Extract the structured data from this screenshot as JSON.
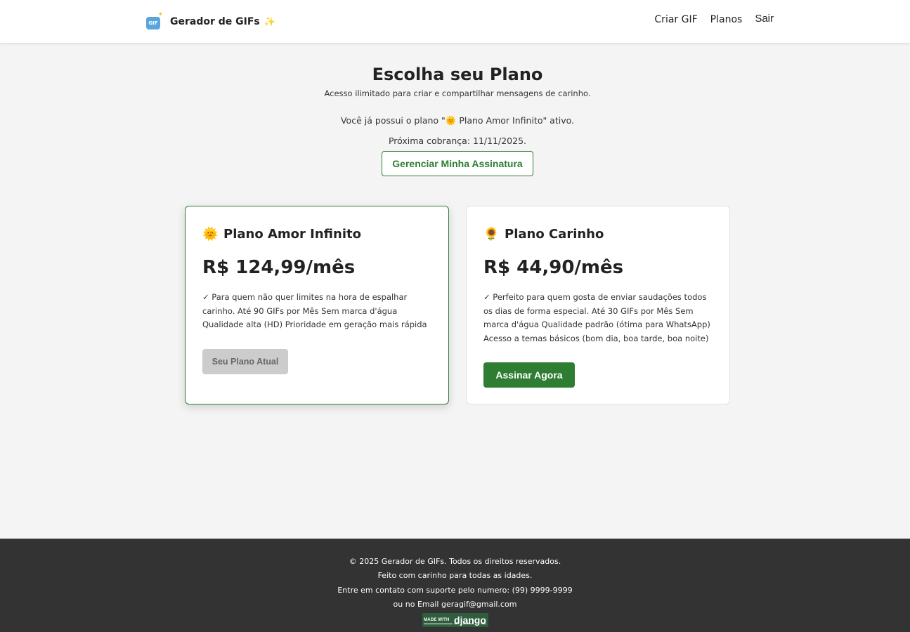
{
  "header": {
    "logo_icon": "gif-icon",
    "logo_text": "GIF",
    "brand_name": "Gerador de GIFs",
    "brand_emoji": "✨",
    "nav": {
      "criar": "Criar GIF",
      "planos": "Planos",
      "sair": "Sair"
    }
  },
  "hero": {
    "title": "Escolha seu Plano",
    "subtitle": "Acesso ilimitado para criar e compartilhar mensagens de carinho.",
    "current_plan_text": "Você já possui o plano \"🌞 Plano Amor Infinito\" ativo.",
    "next_billing": "Próxima cobrança: 11/11/2025.",
    "manage_button": "Gerenciar Minha Assinatura"
  },
  "plans": [
    {
      "icon": "sun-icon",
      "icon_glyph": "🌞",
      "name": "Plano Amor Infinito",
      "price": "R$ 124,99/mês",
      "description": "✓ Para quem não quer limites na hora de espalhar carinho. Até 90 GIFs por Mês Sem marca d'água Qualidade alta (HD) Prioridade em geração mais rápida",
      "button": "Seu Plano Atual",
      "active": true
    },
    {
      "icon": "sunflower-icon",
      "icon_glyph": "🌻",
      "name": "Plano Carinho",
      "price": "R$ 44,90/mês",
      "description": "✓ Perfeito para quem gosta de enviar saudações todos os dias de forma especial. Até 30 GIFs por Mês Sem marca d'água Qualidade padrão (ótima para WhatsApp) Acesso a temas básicos (bom dia, boa tarde, boa noite)",
      "button": "Assinar Agora",
      "active": false
    }
  ],
  "footer": {
    "copyright": "© 2025 Gerador de GIFs. Todos os direitos reservados.",
    "tagline": "Feito com carinho para todas as idades.",
    "support": "Entre em contato com suporte pelo numero: (99) 9999-9999",
    "email": "ou no Email geragif@gmail.com",
    "badge_made": "MADE WITH",
    "badge_django": "django"
  },
  "colors": {
    "accent": "#2e7d32",
    "page_bg": "#f4f4f4",
    "footer_bg": "#333333",
    "disabled_button": "#cccccc"
  }
}
